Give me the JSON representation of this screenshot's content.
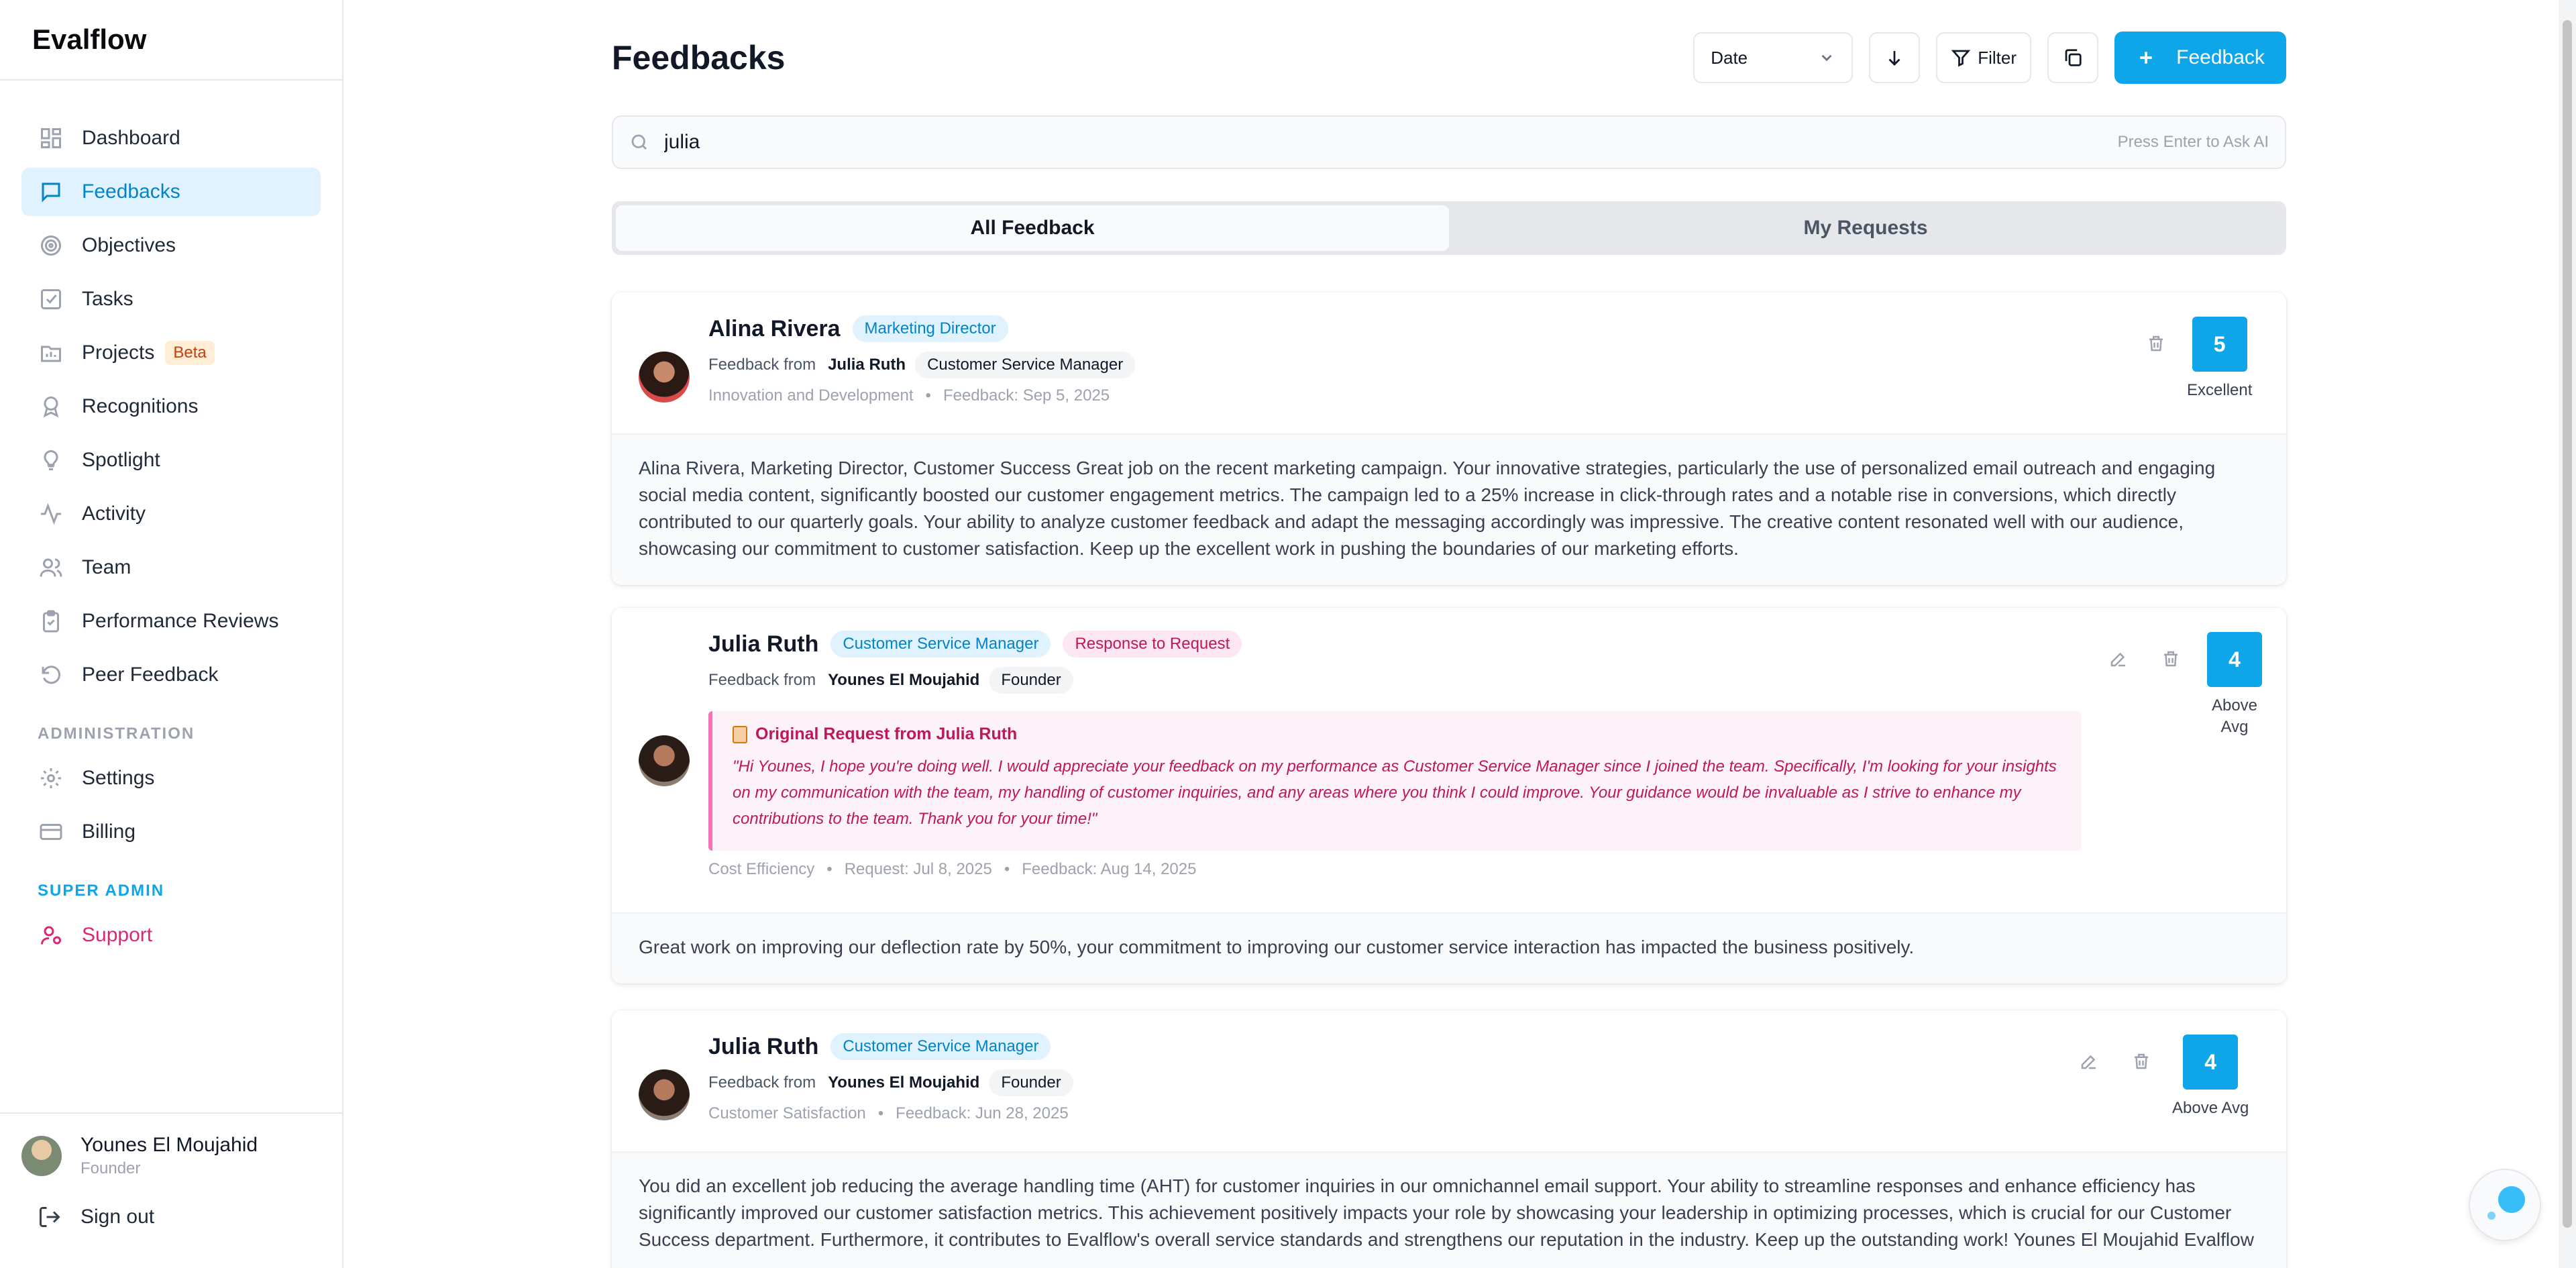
{
  "app": {
    "name": "Evalflow"
  },
  "sidebar": {
    "items": [
      {
        "label": "Dashboard",
        "icon": "grid-icon"
      },
      {
        "label": "Feedbacks",
        "icon": "message-icon",
        "active": true
      },
      {
        "label": "Objectives",
        "icon": "target-icon"
      },
      {
        "label": "Tasks",
        "icon": "checkbox-icon"
      },
      {
        "label": "Projects",
        "icon": "folder-chart-icon",
        "badge": "Beta"
      },
      {
        "label": "Recognitions",
        "icon": "award-icon"
      },
      {
        "label": "Spotlight",
        "icon": "lightbulb-icon"
      },
      {
        "label": "Activity",
        "icon": "activity-icon"
      },
      {
        "label": "Team",
        "icon": "users-icon"
      },
      {
        "label": "Performance Reviews",
        "icon": "clipboard-icon"
      },
      {
        "label": "Peer Feedback",
        "icon": "refresh-icon"
      }
    ],
    "admin_label": "ADMINISTRATION",
    "admin_items": [
      {
        "label": "Settings",
        "icon": "gear-icon"
      },
      {
        "label": "Billing",
        "icon": "credit-card-icon"
      }
    ],
    "super_admin_label": "SUPER ADMIN",
    "super_admin_items": [
      {
        "label": "Support",
        "icon": "user-cog-icon"
      }
    ],
    "user": {
      "name": "Younes El Moujahid",
      "role": "Founder"
    },
    "sign_out": "Sign out"
  },
  "header": {
    "title": "Feedbacks",
    "sort_select": "Date",
    "filter_label": "Filter",
    "add_label": "Feedback"
  },
  "search": {
    "value": "julia",
    "hint": "Press Enter to Ask AI"
  },
  "tabs": [
    {
      "label": "All Feedback",
      "active": true
    },
    {
      "label": "My Requests"
    }
  ],
  "cards": [
    {
      "name": "Alina Rivera",
      "role": "Marketing Director",
      "from_label": "Feedback from",
      "from_name": "Julia Ruth",
      "from_role": "Customer Service Manager",
      "category": "Innovation and Development",
      "feedback_date": "Feedback: Sep 5, 2025",
      "score": "5",
      "score_label": "Excellent",
      "body": "Alina Rivera, Marketing Director, Customer Success Great job on the recent marketing campaign. Your innovative strategies, particularly the use of personalized email outreach and engaging social media content, significantly boosted our customer engagement metrics. The campaign led to a 25% increase in click-through rates and a notable rise in conversions, which directly contributed to our quarterly goals. Your ability to analyze customer feedback and adapt the messaging accordingly was impressive. The creative content resonated well with our audience, showcasing our commitment to customer satisfaction. Keep up the excellent work in pushing the boundaries of our marketing efforts."
    },
    {
      "name": "Julia Ruth",
      "role": "Customer Service Manager",
      "tag": "Response to Request",
      "from_label": "Feedback from",
      "from_name": "Younes El Moujahid",
      "from_role": "Founder",
      "request_title": "Original Request from Julia Ruth",
      "request_text": "\"Hi Younes, I hope you're doing well. I would appreciate your feedback on my performance as Customer Service Manager since I joined the team. Specifically, I'm looking for your insights on my communication with the team, my handling of customer inquiries, and any areas where you think I could improve. Your guidance would be invaluable as I strive to enhance my contributions to the team. Thank you for your time!\"",
      "category": "Cost Efficiency",
      "request_date": "Request: Jul 8, 2025",
      "feedback_date": "Feedback: Aug 14, 2025",
      "score": "4",
      "score_label": "Above Avg",
      "body": "Great work on improving our deflection rate by 50%, your commitment to improving our customer service interaction has impacted the business positively."
    },
    {
      "name": "Julia Ruth",
      "role": "Customer Service Manager",
      "from_label": "Feedback from",
      "from_name": "Younes El Moujahid",
      "from_role": "Founder",
      "category": "Customer Satisfaction",
      "feedback_date": "Feedback: Jun 28, 2025",
      "score": "4",
      "score_label": "Above Avg",
      "body": "You did an excellent job reducing the average handling time (AHT) for customer inquiries in our omnichannel email support. Your ability to streamline responses and enhance efficiency has significantly improved our customer satisfaction metrics. This achievement positively impacts your role by showcasing your leadership in optimizing processes, which is crucial for our Customer Success department. Furthermore, it contributes to Evalflow's overall service standards and strengthens our reputation in the industry. Keep up the outstanding work! Younes El Moujahid Evalflow"
    }
  ],
  "colors": {
    "accent": "#0ea5e9",
    "active_bg": "#e0f2fe",
    "support": "#db2777",
    "request": "#be185d"
  }
}
